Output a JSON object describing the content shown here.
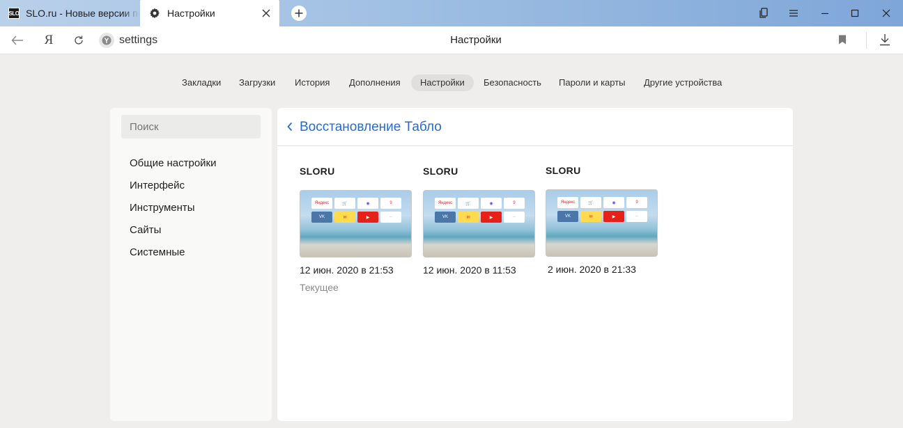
{
  "browser": {
    "tabs": [
      {
        "favicon": "SLO",
        "title": "SLO.ru - Новые версии по"
      },
      {
        "title": "Настройки"
      }
    ],
    "address": {
      "url": "settings",
      "page_title": "Настройки"
    }
  },
  "settings_nav": [
    {
      "label": "Закладки"
    },
    {
      "label": "Загрузки"
    },
    {
      "label": "История"
    },
    {
      "label": "Дополнения"
    },
    {
      "label": "Настройки"
    },
    {
      "label": "Безопасность"
    },
    {
      "label": "Пароли и карты"
    },
    {
      "label": "Другие устройства"
    }
  ],
  "sidebar": {
    "search_placeholder": "Поиск",
    "items": [
      {
        "label": "Общие настройки"
      },
      {
        "label": "Интерфейс"
      },
      {
        "label": "Инструменты"
      },
      {
        "label": "Сайты"
      },
      {
        "label": "Системные"
      }
    ]
  },
  "panel": {
    "title": "Восстановление Табло",
    "snapshots": [
      {
        "title": "SLORU",
        "date": "12 июн. 2020 в 21:53",
        "status": "Текущее"
      },
      {
        "title": "SLORU",
        "date": "12 июн. 2020 в 11:53",
        "status": ""
      },
      {
        "title": "SLORU",
        "date": "2 июн. 2020 в 21:33",
        "status": ""
      }
    ]
  },
  "thumbnail_tiles": [
    {
      "label": "Яндекс",
      "color": "#d22",
      "bg": "#ffffff"
    },
    {
      "label": "🛒",
      "color": "#3a7bd5",
      "bg": "#ffffff"
    },
    {
      "label": "◉",
      "color": "#6a4bd8",
      "bg": "#ffffff"
    },
    {
      "label": "9",
      "color": "#e53935",
      "bg": "#ffffff"
    },
    {
      "label": "VK",
      "color": "#ffffff",
      "bg": "#4a76a8"
    },
    {
      "label": "✉",
      "color": "#d32f2f",
      "bg": "#ffdb4d"
    },
    {
      "label": "▶",
      "color": "#ffffff",
      "bg": "#e62117"
    },
    {
      "label": "··",
      "color": "#666",
      "bg": "#ffffff"
    }
  ],
  "colors": {
    "accent_link": "#2a6bc9",
    "page_bg": "#efeeec",
    "active_nav_bg": "#e0dfdd"
  }
}
